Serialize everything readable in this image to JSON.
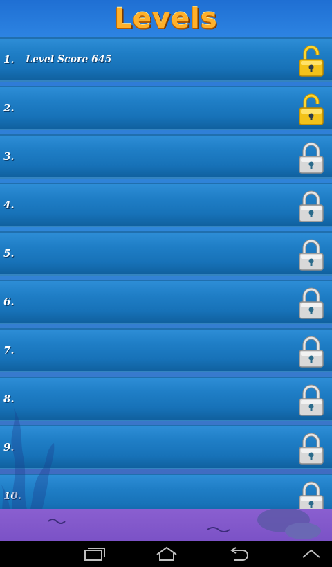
{
  "header": {
    "title": "Levels"
  },
  "levels": [
    {
      "number": "1.",
      "score_text": "Level Score  645",
      "lock_state": "unlocked"
    },
    {
      "number": "2.",
      "score_text": "",
      "lock_state": "unlocked"
    },
    {
      "number": "3.",
      "score_text": "",
      "lock_state": "locked"
    },
    {
      "number": "4.",
      "score_text": "",
      "lock_state": "locked"
    },
    {
      "number": "5.",
      "score_text": "",
      "lock_state": "locked"
    },
    {
      "number": "6.",
      "score_text": "",
      "lock_state": "locked"
    },
    {
      "number": "7.",
      "score_text": "",
      "lock_state": "locked"
    },
    {
      "number": "8.",
      "score_text": "",
      "lock_state": "locked"
    },
    {
      "number": "9.",
      "score_text": "",
      "lock_state": "locked"
    },
    {
      "number": "10.",
      "score_text": "",
      "lock_state": "locked"
    }
  ],
  "icons": {
    "unlocked": "padlock-open-icon",
    "locked": "padlock-closed-icon"
  },
  "colors": {
    "unlocked_lock": "#f2c21a",
    "locked_lock": "#d8d8d8",
    "title": "#ffb12a"
  },
  "system_nav": [
    {
      "icon": "recent-apps-icon"
    },
    {
      "icon": "home-icon"
    },
    {
      "icon": "back-icon"
    },
    {
      "icon": "chevron-up-icon"
    }
  ]
}
